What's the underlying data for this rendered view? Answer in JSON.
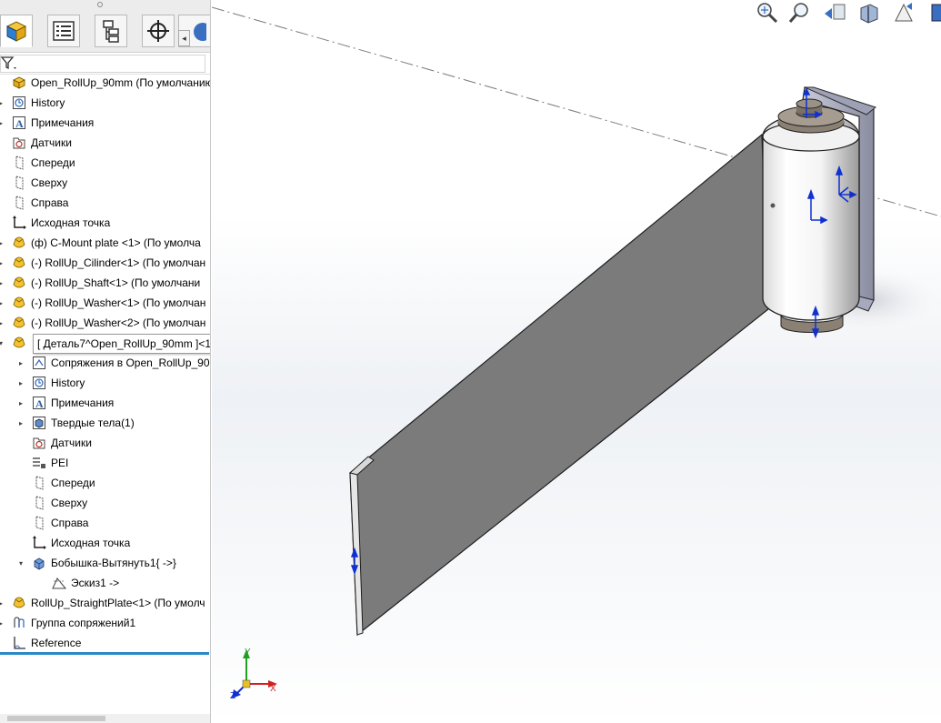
{
  "feature_tree": {
    "tabs": [
      {
        "name": "tab-feature-manager",
        "icon": "feature-manager-icon",
        "active": true
      },
      {
        "name": "tab-property-manager",
        "icon": "property-manager-icon",
        "active": false
      },
      {
        "name": "tab-configuration-manager",
        "icon": "configuration-manager-icon",
        "active": false
      },
      {
        "name": "tab-dimxpert-manager",
        "icon": "dimxpert-icon",
        "active": false
      },
      {
        "name": "tab-display-manager",
        "icon": "display-manager-icon",
        "active": false
      }
    ],
    "items": [
      {
        "label": "Open_RollUp_90mm  (По умолчанию<I",
        "icon": "assembly-icon",
        "expander": "",
        "level": 0
      },
      {
        "label": "History",
        "icon": "history-icon",
        "expander": "▸",
        "level": 1
      },
      {
        "label": "Примечания",
        "icon": "annotations-icon",
        "expander": "▸",
        "level": 1
      },
      {
        "label": "Датчики",
        "icon": "sensors-icon",
        "expander": "",
        "level": 1
      },
      {
        "label": "Спереди",
        "icon": "plane-icon",
        "expander": "",
        "level": 1
      },
      {
        "label": "Сверху",
        "icon": "plane-icon",
        "expander": "",
        "level": 1
      },
      {
        "label": "Справа",
        "icon": "plane-icon",
        "expander": "",
        "level": 1
      },
      {
        "label": "Исходная точка",
        "icon": "origin-icon",
        "expander": "",
        "level": 1
      },
      {
        "label": "(ф) C-Mount plate <1> (По умолча",
        "icon": "part-icon",
        "expander": "▸",
        "level": 1
      },
      {
        "label": "(-) RollUp_Cilinder<1> (По умолчан",
        "icon": "part-icon",
        "expander": "▸",
        "level": 1
      },
      {
        "label": "(-) RollUp_Shaft<1> (По умолчани",
        "icon": "part-icon",
        "expander": "▸",
        "level": 1
      },
      {
        "label": "(-) RollUp_Washer<1> (По умолчан",
        "icon": "part-icon",
        "expander": "▸",
        "level": 1
      },
      {
        "label": "(-) RollUp_Washer<2> (По умолчан",
        "icon": "part-icon",
        "expander": "▸",
        "level": 1
      },
      {
        "label": "",
        "icon": "part-icon",
        "expander": "▾",
        "level": 1
      },
      {
        "label": "Сопряжения в Open_RollUp_90",
        "icon": "mates-icon",
        "expander": "▸",
        "level": 2
      },
      {
        "label": "History",
        "icon": "history-icon",
        "expander": "▸",
        "level": 2
      },
      {
        "label": "Примечания",
        "icon": "annotations-icon",
        "expander": "▸",
        "level": 2
      },
      {
        "label": "Твердые тела(1)",
        "icon": "solid-bodies-icon",
        "expander": "▸",
        "level": 2
      },
      {
        "label": "Датчики",
        "icon": "sensors-icon",
        "expander": "",
        "level": 2
      },
      {
        "label": "PEI",
        "icon": "material-icon",
        "expander": "",
        "level": 2
      },
      {
        "label": "Спереди",
        "icon": "plane-icon",
        "expander": "",
        "level": 2
      },
      {
        "label": "Сверху",
        "icon": "plane-icon",
        "expander": "",
        "level": 2
      },
      {
        "label": "Справа",
        "icon": "plane-icon",
        "expander": "",
        "level": 2
      },
      {
        "label": "Исходная точка",
        "icon": "origin-icon",
        "expander": "",
        "level": 2
      },
      {
        "label": "Бобышка-Вытянуть1{ ->}",
        "icon": "extrude-icon",
        "expander": "▾",
        "level": 2
      },
      {
        "label": "Эскиз1 ->",
        "icon": "sketch-icon",
        "expander": "",
        "level": 3
      },
      {
        "label": "RollUp_StraightPlate<1> (По умолч",
        "icon": "part-icon",
        "expander": "▸",
        "level": 1
      },
      {
        "label": "Группа сопряжений1",
        "icon": "mates-group-icon",
        "expander": "▸",
        "level": 1
      },
      {
        "label": "Reference",
        "icon": "reference-icon",
        "expander": "",
        "level": 1
      }
    ],
    "hover_tooltip": "[ Деталь7^Open_RollUp_90mm ]<1:"
  },
  "view_toolbar": [
    {
      "name": "zoom-to-fit-icon"
    },
    {
      "name": "zoom-to-area-icon"
    },
    {
      "name": "previous-view-icon"
    },
    {
      "name": "section-view-icon"
    },
    {
      "name": "dynamic-annotation-icon"
    },
    {
      "name": "view-orientation-icon"
    }
  ],
  "triad": {
    "x_label": "X",
    "y_label": "Y",
    "z_label": "Z"
  },
  "colors": {
    "accent": "#2a88c8",
    "part_yellow": "#f0c020",
    "plate_gray": "#7b7b7b",
    "axis_blue": "#1030d0",
    "axis_red": "#d02020",
    "axis_green": "#20a020"
  }
}
